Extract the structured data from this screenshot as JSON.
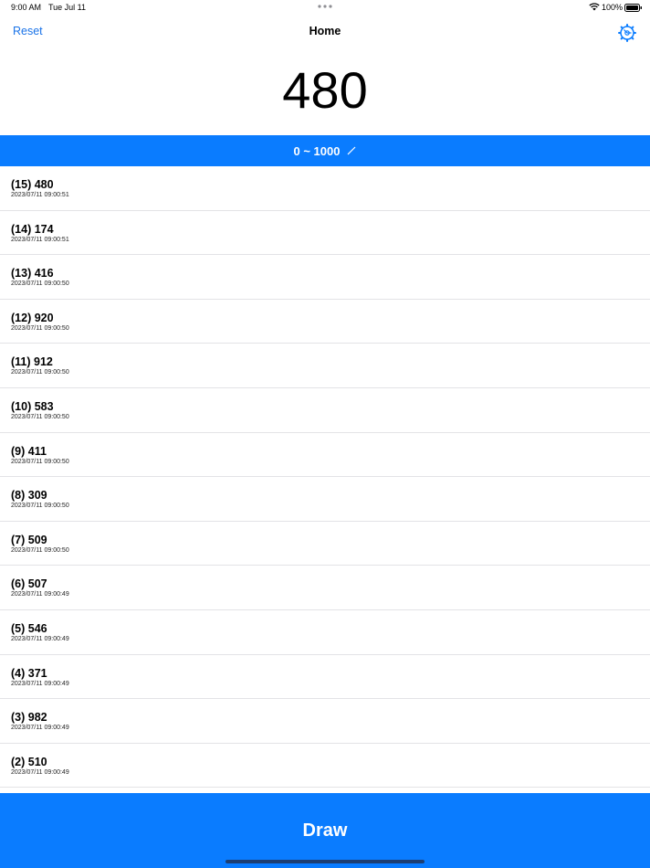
{
  "status_bar": {
    "time": "9:00 AM",
    "date": "Tue Jul 11",
    "battery": "100%"
  },
  "nav": {
    "reset_label": "Reset",
    "title": "Home",
    "settings_icon": "gear-icon"
  },
  "current_number": "480",
  "range": {
    "label": "0 ~ 1000",
    "icon": "pencil-icon"
  },
  "history": [
    {
      "label": "(15) 480",
      "timestamp": "2023/07/11 09:00:51"
    },
    {
      "label": "(14) 174",
      "timestamp": "2023/07/11 09:00:51"
    },
    {
      "label": "(13) 416",
      "timestamp": "2023/07/11 09:00:50"
    },
    {
      "label": "(12) 920",
      "timestamp": "2023/07/11 09:00:50"
    },
    {
      "label": "(11) 912",
      "timestamp": "2023/07/11 09:00:50"
    },
    {
      "label": "(10) 583",
      "timestamp": "2023/07/11 09:00:50"
    },
    {
      "label": "(9) 411",
      "timestamp": "2023/07/11 09:00:50"
    },
    {
      "label": "(8) 309",
      "timestamp": "2023/07/11 09:00:50"
    },
    {
      "label": "(7) 509",
      "timestamp": "2023/07/11 09:00:50"
    },
    {
      "label": "(6) 507",
      "timestamp": "2023/07/11 09:00:49"
    },
    {
      "label": "(5) 546",
      "timestamp": "2023/07/11 09:00:49"
    },
    {
      "label": "(4) 371",
      "timestamp": "2023/07/11 09:00:49"
    },
    {
      "label": "(3) 982",
      "timestamp": "2023/07/11 09:00:49"
    },
    {
      "label": "(2) 510",
      "timestamp": "2023/07/11 09:00:49"
    }
  ],
  "draw_label": "Draw",
  "colors": {
    "accent": "#0a7cff",
    "link": "#1a73e8"
  }
}
